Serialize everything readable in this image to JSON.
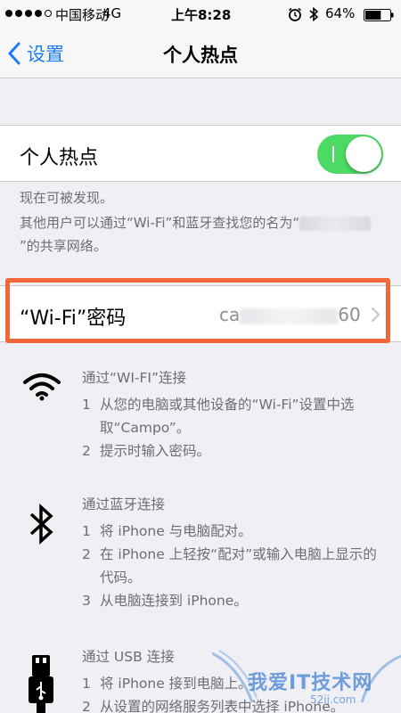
{
  "status_bar": {
    "carrier": "中国移动",
    "network": "4G",
    "time": "上午8:28",
    "battery": "64%",
    "battery_level": 0.64
  },
  "nav": {
    "back_label": "设置",
    "title": "个人热点"
  },
  "hotspot": {
    "label": "个人热点",
    "enabled": true,
    "discoverable_note": "现在可被发现。",
    "share_note_prefix": "其他用户可以通过“Wi-Fi”和蓝牙查找您的名为“",
    "share_note_suffix": "”的共享网络。"
  },
  "wifi_password": {
    "label": "“Wi-Fi”密码",
    "value_prefix": "ca",
    "value_suffix": "60"
  },
  "instructions": {
    "wifi": {
      "title": "通过“WI-FI”连接",
      "steps": [
        {
          "num": "1",
          "text": "从您的电脑或其他设备的“Wi-Fi”设置中选取“Campo”。"
        },
        {
          "num": "2",
          "text": "提示时输入密码。"
        }
      ]
    },
    "bluetooth": {
      "title": "通过蓝牙连接",
      "steps": [
        {
          "num": "1",
          "text": "将 iPhone 与电脑配对。"
        },
        {
          "num": "2",
          "text": "在 iPhone 上轻按“配对”或输入电脑上显示的代码。"
        },
        {
          "num": "3",
          "text": "从电脑连接到 iPhone。"
        }
      ]
    },
    "usb": {
      "title": "通过 USB 连接",
      "steps": [
        {
          "num": "1",
          "text": "将 iPhone 接到电脑上。"
        },
        {
          "num": "2",
          "text": "从设置的网络服务列表中选择 iPhone。"
        }
      ]
    }
  },
  "watermark": {
    "text": "我爱IT技术网",
    "sub": "52ij.com"
  },
  "colors": {
    "accent": "#1a7df2",
    "toggle_on": "#4cd964",
    "highlight": "#f2673a"
  }
}
